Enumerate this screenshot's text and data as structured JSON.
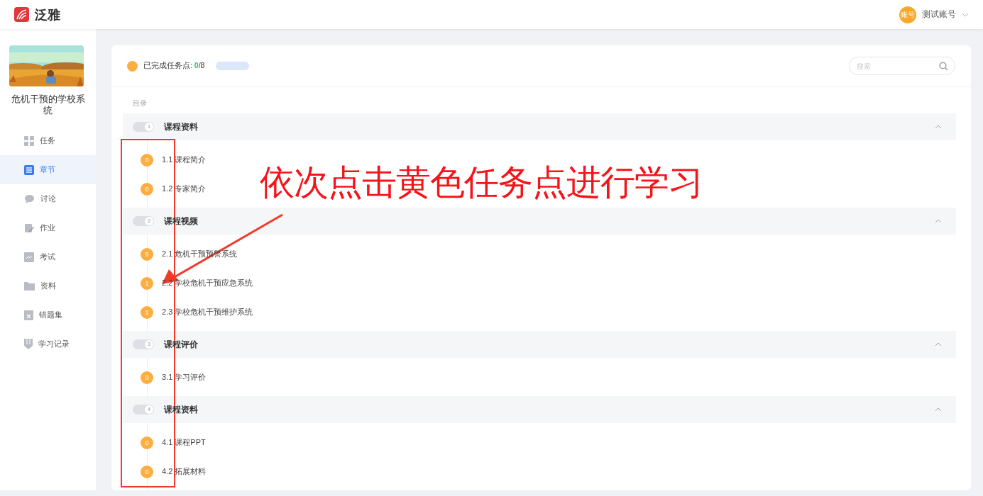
{
  "header": {
    "logo_text": "泛雅",
    "user": {
      "avatar_text": "账号",
      "name": "测试账号"
    }
  },
  "sidebar": {
    "course": {
      "title": "危机干预的学校系统"
    },
    "items": [
      {
        "label": "任务",
        "kind": "grid",
        "selected": false
      },
      {
        "label": "章节",
        "kind": "list",
        "selected": true
      },
      {
        "label": "讨论",
        "kind": "chat",
        "selected": false
      },
      {
        "label": "作业",
        "kind": "edit",
        "selected": false
      },
      {
        "label": "考试",
        "kind": "exam",
        "selected": false
      },
      {
        "label": "资料",
        "kind": "folder",
        "selected": false
      },
      {
        "label": "错题集",
        "kind": "wrong",
        "selected": false
      },
      {
        "label": "学习记录",
        "kind": "record",
        "selected": false
      }
    ]
  },
  "progress": {
    "label": "已完成任务点: ",
    "done": "0",
    "total": "/8",
    "level": 0
  },
  "search": {
    "placeholder": "搜索"
  },
  "toc_label": "目录",
  "chapters": [
    {
      "number": "1",
      "title": "课程资料",
      "expanded": true,
      "items": [
        {
          "badge": "0",
          "title": "1.1 课程简介"
        },
        {
          "badge": "0",
          "title": "1.2 专家简介"
        }
      ]
    },
    {
      "number": "2",
      "title": "课程视频",
      "expanded": true,
      "items": [
        {
          "badge": "6",
          "title": "2.1 危机干预预警系统"
        },
        {
          "badge": "1",
          "title": "2.2 学校危机干预应急系统"
        },
        {
          "badge": "1",
          "title": "2.3 学校危机干预维护系统"
        }
      ]
    },
    {
      "number": "3",
      "title": "课程评价",
      "expanded": true,
      "items": [
        {
          "badge": "0",
          "title": "3.1 学习评价"
        }
      ]
    },
    {
      "number": "4",
      "title": "课程资料",
      "expanded": true,
      "items": [
        {
          "badge": "0",
          "title": "4.1 课程PPT"
        },
        {
          "badge": "0",
          "title": "4.2 拓展材料"
        }
      ]
    }
  ],
  "annotation": {
    "text": "依次点击黄色任务点进行学习"
  }
}
